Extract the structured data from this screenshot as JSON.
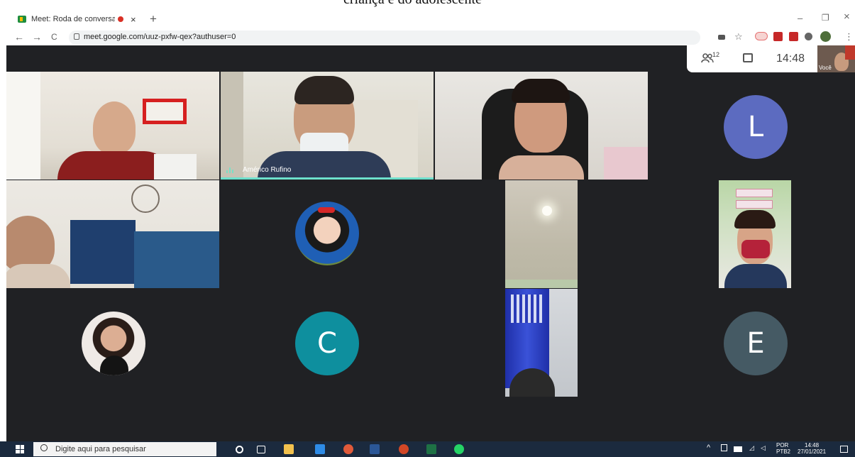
{
  "caption": "criança e do adolescente",
  "browser": {
    "tab_title": "Meet: Roda de conversa con",
    "tab_close": "×",
    "new_tab": "+",
    "url": "meet.google.com/uuz-pxfw-qex?authuser=0",
    "minimize": "–",
    "maximize": "❐",
    "close": "×",
    "back": "←",
    "forward": "→",
    "reload": "C",
    "star": "☆",
    "menu": "⋮"
  },
  "meet": {
    "participant_count": "12",
    "clock": "14:48",
    "self_label": "Você",
    "speaker_name": "Américo Rufino",
    "avatars": [
      {
        "letter": "L",
        "color": "#5c6bc0"
      },
      {
        "letter": "C",
        "color": "#0e8f9e"
      },
      {
        "letter": "E",
        "color": "#455a64"
      }
    ]
  },
  "taskbar": {
    "search_placeholder": "Digite aqui para pesquisar",
    "lang_top": "POR",
    "lang_bottom": "PTB2",
    "time": "14:48",
    "date": "27/01/2021"
  }
}
